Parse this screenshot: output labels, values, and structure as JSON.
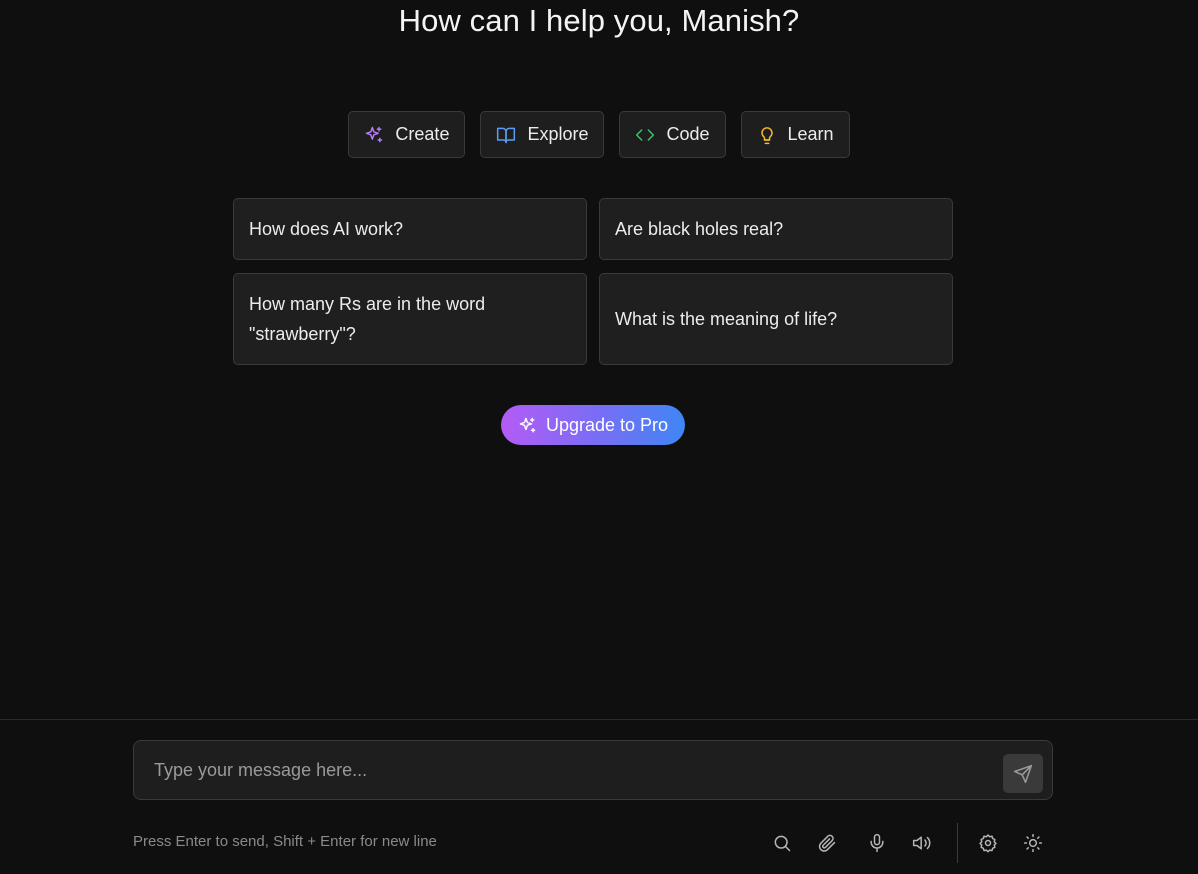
{
  "greeting": "How can I help you, Manish?",
  "categories": [
    {
      "label": "Create",
      "icon": "sparkles-icon",
      "color": "#b57cf5"
    },
    {
      "label": "Explore",
      "icon": "book-open-icon",
      "color": "#5b9cf5"
    },
    {
      "label": "Code",
      "icon": "code-icon",
      "color": "#35c46d"
    },
    {
      "label": "Learn",
      "icon": "lightbulb-icon",
      "color": "#f5b82e"
    }
  ],
  "prompts": [
    "How does AI work?",
    "Are black holes real?",
    "How many Rs are in the word \"strawberry\"?",
    "What is the meaning of life?"
  ],
  "upgrade": {
    "label": "Upgrade to Pro",
    "icon": "sparkles-icon",
    "gradient": [
      "#b35cf5",
      "#3f86f4"
    ]
  },
  "composer": {
    "placeholder": "Type your message here...",
    "value": "",
    "send_icon": "send-icon"
  },
  "hint": "Press Enter to send, Shift + Enter for new line",
  "toolbar": {
    "icons": [
      "search-icon",
      "paperclip-icon",
      "microphone-icon",
      "speaker-icon",
      "gear-icon",
      "sun-icon"
    ]
  },
  "colors": {
    "background": "#0f0f0f",
    "card": "#1f1f1f",
    "border": "#3a3a3a"
  }
}
